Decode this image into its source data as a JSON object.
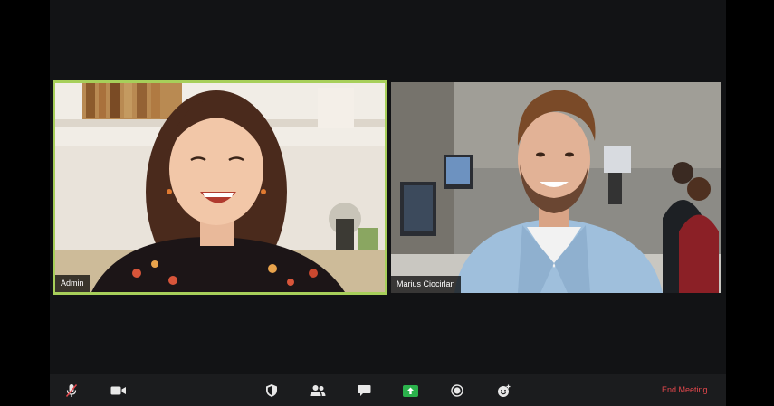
{
  "participants": [
    {
      "name": "Admin",
      "active_speaker": true
    },
    {
      "name": "Marius Ciocirlan",
      "active_speaker": false
    }
  ],
  "toolbar": {
    "items": [
      {
        "icon": "mic-muted-icon"
      },
      {
        "icon": "video-camera-icon"
      },
      {
        "icon": "security-shield-icon"
      },
      {
        "icon": "participants-icon"
      },
      {
        "icon": "chat-bubble-icon"
      },
      {
        "icon": "share-screen-icon"
      },
      {
        "icon": "record-icon"
      },
      {
        "icon": "reactions-icon"
      }
    ],
    "end_label": "End Meeting"
  },
  "colors": {
    "active_speaker_border": "#a7cf5a",
    "end_meeting": "#e5484d",
    "share_screen": "#2bb24c"
  }
}
